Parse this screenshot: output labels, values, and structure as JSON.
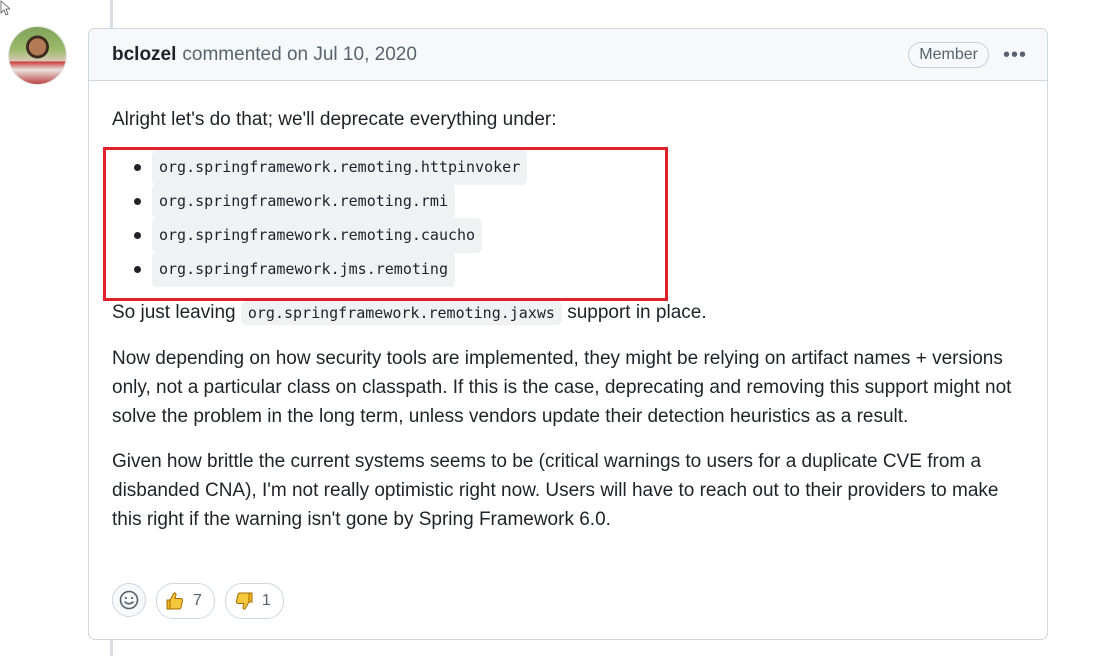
{
  "comment": {
    "author": "bclozel",
    "action_text": "commented on Jul 10, 2020",
    "badge": "Member",
    "more_label": "•••",
    "intro": "Alright let's do that; we'll deprecate everything under:",
    "packages": [
      "org.springframework.remoting.httpinvoker",
      "org.springframework.remoting.rmi",
      "org.springframework.remoting.caucho",
      "org.springframework.jms.remoting"
    ],
    "keep_prefix": "So just leaving",
    "keep_code": "org.springframework.remoting.jaxws",
    "keep_suffix": "support in place.",
    "paragraph_2": "Now depending on how security tools are implemented, they might be relying on artifact names + versions only, not a particular class on classpath. If this is the case, deprecating and removing this support might not solve the problem in the long term, unless vendors update their detection heuristics as a result.",
    "paragraph_3": "Given how brittle the current systems seems to be (critical warnings to users for a duplicate CVE from a disbanded CNA), I'm not really optimistic right now. Users will have to reach out to their providers to make this right if the warning isn't gone by Spring Framework 6.0."
  },
  "reactions": {
    "add_icon": "smiley-icon",
    "thumbs_up": {
      "icon": "thumbs-up-icon",
      "count": "7"
    },
    "thumbs_down": {
      "icon": "thumbs-down-icon",
      "count": "1"
    }
  },
  "colors": {
    "highlight_border": "#e0202a",
    "header_bg": "#f6f8fa",
    "border": "#d0d7de"
  }
}
